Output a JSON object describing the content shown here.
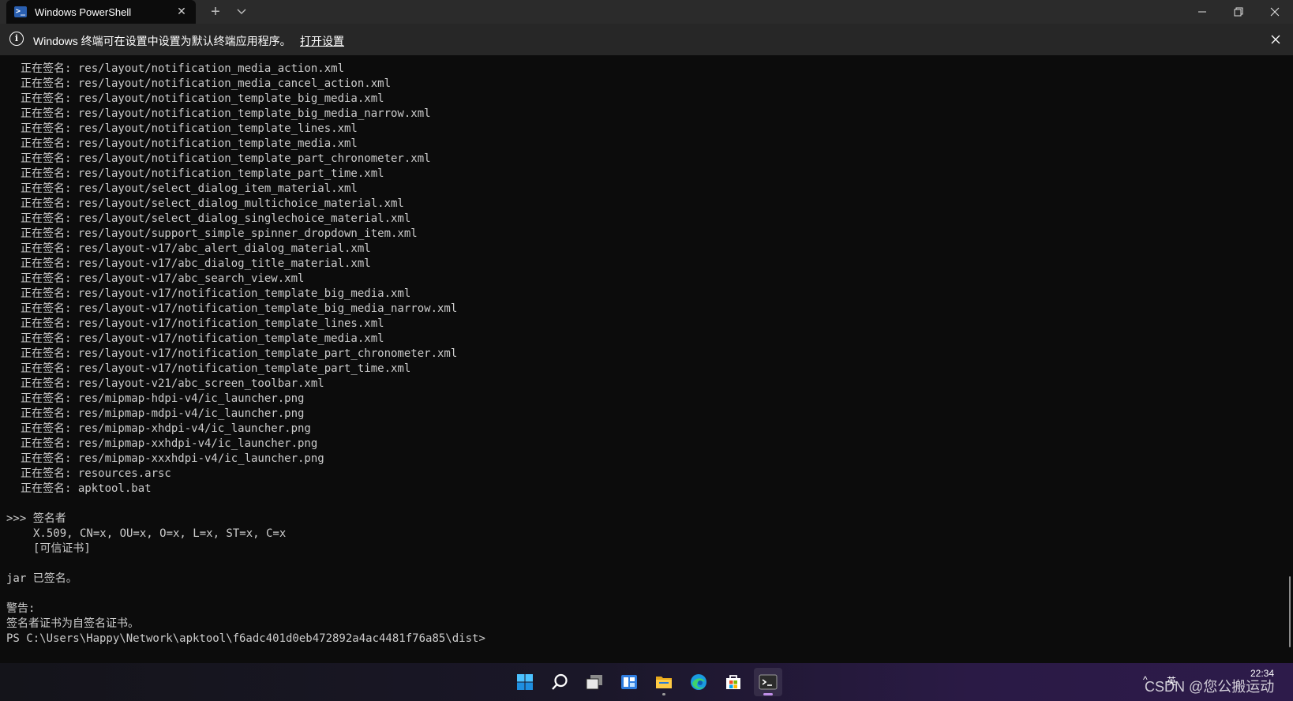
{
  "window": {
    "tab_title": "Windows PowerShell",
    "tab_icon": "powershell-icon",
    "new_tab_symbol": "+",
    "dropdown_symbol": "⌵",
    "close_symbol": "✕",
    "minimize_symbol": "—",
    "maximize_symbol": "❐"
  },
  "infobar": {
    "message": "Windows 终端可在设置中设置为默认终端应用程序。",
    "link": "打开设置",
    "icon": "info-icon"
  },
  "terminal": {
    "signing_prefix": "正在签名:",
    "signing_files": [
      "res/layout/notification_media_action.xml",
      "res/layout/notification_media_cancel_action.xml",
      "res/layout/notification_template_big_media.xml",
      "res/layout/notification_template_big_media_narrow.xml",
      "res/layout/notification_template_lines.xml",
      "res/layout/notification_template_media.xml",
      "res/layout/notification_template_part_chronometer.xml",
      "res/layout/notification_template_part_time.xml",
      "res/layout/select_dialog_item_material.xml",
      "res/layout/select_dialog_multichoice_material.xml",
      "res/layout/select_dialog_singlechoice_material.xml",
      "res/layout/support_simple_spinner_dropdown_item.xml",
      "res/layout-v17/abc_alert_dialog_material.xml",
      "res/layout-v17/abc_dialog_title_material.xml",
      "res/layout-v17/abc_search_view.xml",
      "res/layout-v17/notification_template_big_media.xml",
      "res/layout-v17/notification_template_big_media_narrow.xml",
      "res/layout-v17/notification_template_lines.xml",
      "res/layout-v17/notification_template_media.xml",
      "res/layout-v17/notification_template_part_chronometer.xml",
      "res/layout-v17/notification_template_part_time.xml",
      "res/layout-v21/abc_screen_toolbar.xml",
      "res/mipmap-hdpi-v4/ic_launcher.png",
      "res/mipmap-mdpi-v4/ic_launcher.png",
      "res/mipmap-xhdpi-v4/ic_launcher.png",
      "res/mipmap-xxhdpi-v4/ic_launcher.png",
      "res/mipmap-xxxhdpi-v4/ic_launcher.png",
      "resources.arsc",
      "apktool.bat"
    ],
    "signer_header": ">>> 签名者",
    "signer_dn": "X.509, CN=x, OU=x, O=x, L=x, ST=x, C=x",
    "signer_trust": "[可信证书]",
    "jar_signed": "jar 已签名。",
    "warning_label": "警告:",
    "warning_text": "签名者证书为自签名证书。",
    "prompt": "PS C:\\Users\\Happy\\Network\\apktool\\f6adc401d0eb472892a4ac4481f76a85\\dist>"
  },
  "taskbar": {
    "items": [
      {
        "name": "start-icon",
        "active": false
      },
      {
        "name": "search-icon",
        "active": false
      },
      {
        "name": "task-view-icon",
        "active": false
      },
      {
        "name": "widgets-icon",
        "active": false
      },
      {
        "name": "file-explorer-icon",
        "active": false,
        "running": true
      },
      {
        "name": "edge-icon",
        "active": false
      },
      {
        "name": "store-icon",
        "active": false
      },
      {
        "name": "terminal-icon",
        "active": true
      }
    ],
    "tray_chevron": "^",
    "ime": "英",
    "clock_time": "22:34"
  },
  "watermark": "CSDN @您公搬运动",
  "colors": {
    "terminal_bg": "#0c0c0c",
    "terminal_fg": "#cccccc",
    "titlebar_bg": "#2b2b2b",
    "infobar_bg": "#272727",
    "accent": "#c08ee8"
  }
}
